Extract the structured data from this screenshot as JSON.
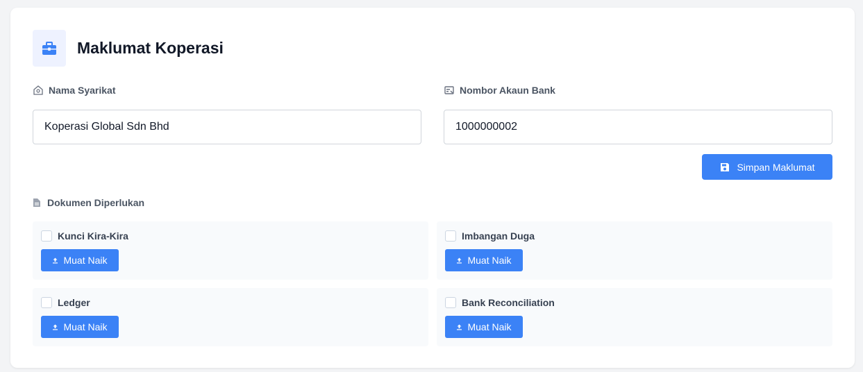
{
  "header": {
    "title": "Maklumat Koperasi",
    "icon": "briefcase-icon"
  },
  "fields": {
    "company": {
      "label": "Nama Syarikat",
      "value": "Koperasi Global Sdn Bhd",
      "icon": "building-icon"
    },
    "bank": {
      "label": "Nombor Akaun Bank",
      "value": "1000000002",
      "icon": "bank-card-icon"
    }
  },
  "save_button": {
    "label": "Simpan Maklumat",
    "icon": "save-icon"
  },
  "documents": {
    "label": "Dokumen Diperlukan",
    "icon": "document-icon",
    "upload_label": "Muat Naik",
    "items": [
      {
        "name": "Kunci Kira-Kira",
        "checked": false
      },
      {
        "name": "Imbangan Duga",
        "checked": false
      },
      {
        "name": "Ledger",
        "checked": false
      },
      {
        "name": "Bank Reconciliation",
        "checked": false
      }
    ]
  },
  "colors": {
    "accent": "#3b82f6",
    "card_bg": "#ffffff",
    "tile_bg": "#f8fafc"
  }
}
